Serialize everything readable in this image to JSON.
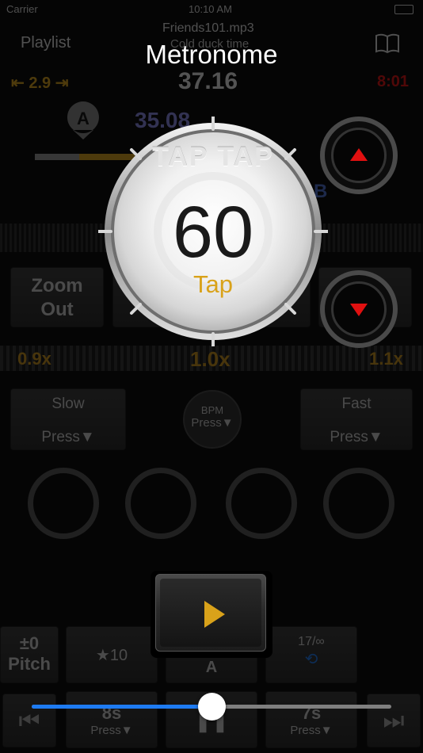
{
  "background": {
    "status_bar": {
      "carrier": "Carrier",
      "time": "10:10 AM"
    },
    "header": {
      "playlist_label": "Playlist",
      "filename": "Friends101.mp3",
      "subtitle": "Cold duck time"
    },
    "position": {
      "left_value": "2.9",
      "current_time": "37.16",
      "total_time": "8:01"
    },
    "ab": {
      "marker_a": "A",
      "marker_time": "35.08",
      "marker_b": "B"
    },
    "zoom": {
      "zoom_out_label_1": "Zoom",
      "zoom_out_label_2": "Out"
    },
    "speed": {
      "left": "0.9x",
      "center": "1.0x",
      "right": "1.1x"
    },
    "speed_buttons": {
      "slow_label": "Slow",
      "slow_press": "Press▼",
      "bpm_label": "BPM",
      "bpm_press": "Press▼",
      "fast_label": "Fast",
      "fast_press": "Press▼"
    },
    "bottom_buttons": {
      "pitch_value": "±0",
      "pitch_label": "Pitch",
      "star_label": "★10",
      "a_label": "A",
      "loop_label": "17/∞"
    },
    "skip": {
      "back_label": "8s",
      "back_press": "Press▼",
      "fwd_label": "7s",
      "fwd_press": "Press▼"
    },
    "progress": 0.5
  },
  "metronome": {
    "title": "Metronome",
    "logo_text": "TAP TAP",
    "bpm": "60",
    "tap_label": "Tap"
  },
  "colors": {
    "accent_gold": "#D9A21A",
    "arrow_red": "#E01010",
    "slider_blue": "#1E7BF2",
    "speed_gold": "#C9931A"
  }
}
